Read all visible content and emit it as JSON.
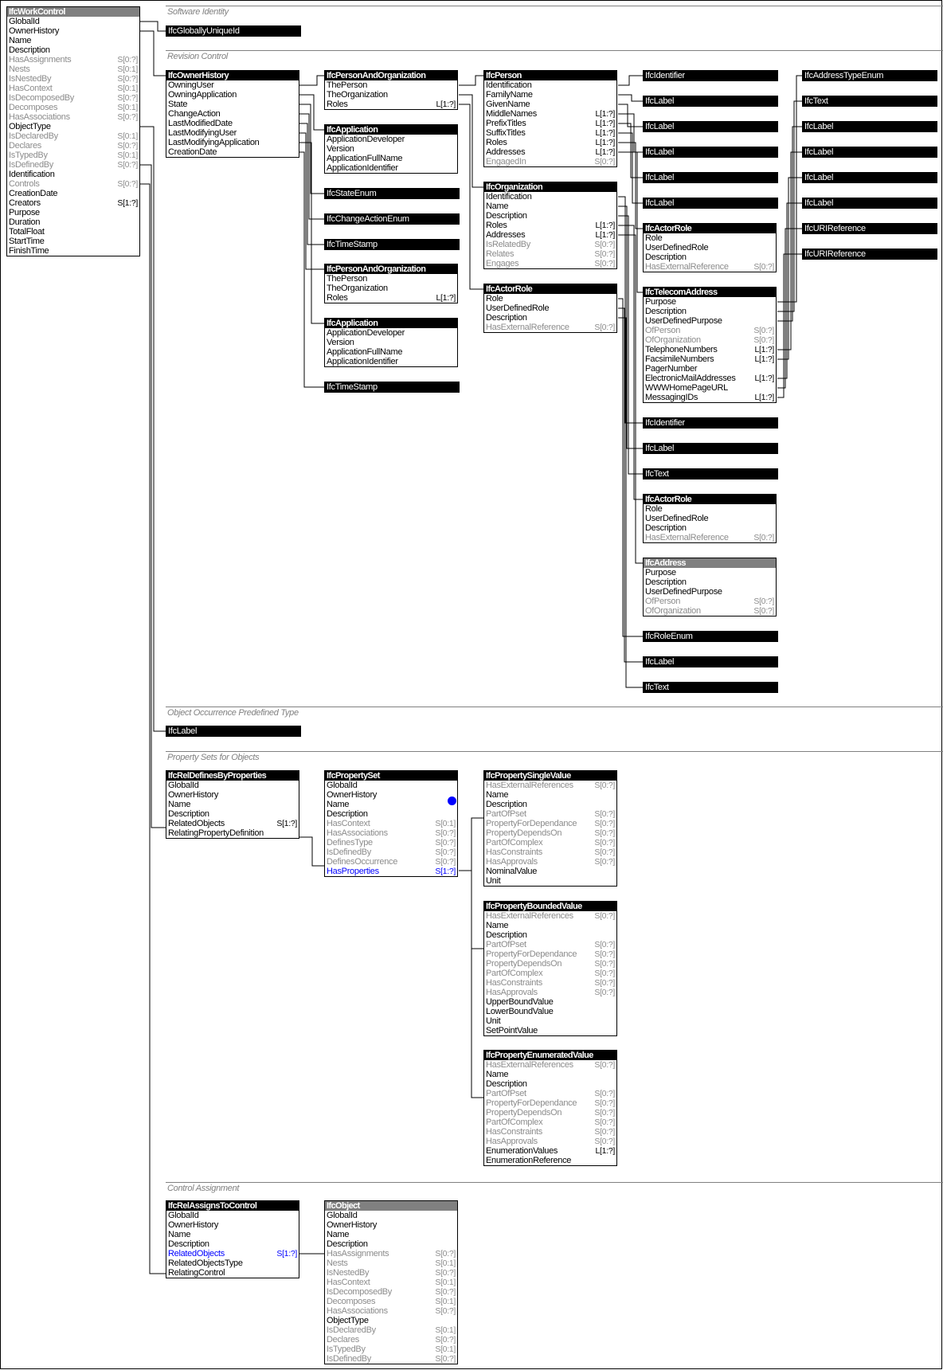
{
  "colors": {
    "header": "#000000",
    "abstract_header": "#808080",
    "inverse_attr": "#8c8c8c",
    "link_attr": "#0000ff",
    "section_title": "#808080",
    "selection_dot": "#0000ff"
  },
  "sections": [
    {
      "title": "Software Identity"
    },
    {
      "title": "Revision Control"
    },
    {
      "title": "Object Occurrence Predefined Type"
    },
    {
      "title": "Property Sets for Objects"
    },
    {
      "title": "Control Assignment"
    }
  ],
  "entities": {
    "work_control": {
      "name": "IfcWorkControl",
      "abstract": true,
      "attrs": [
        {
          "n": "GlobalId"
        },
        {
          "n": "OwnerHistory"
        },
        {
          "n": "Name"
        },
        {
          "n": "Description"
        },
        {
          "n": "HasAssignments",
          "c": "S[0:?]",
          "inv": true
        },
        {
          "n": "Nests",
          "c": "S[0:1]",
          "inv": true
        },
        {
          "n": "IsNestedBy",
          "c": "S[0:?]",
          "inv": true
        },
        {
          "n": "HasContext",
          "c": "S[0:1]",
          "inv": true
        },
        {
          "n": "IsDecomposedBy",
          "c": "S[0:?]",
          "inv": true
        },
        {
          "n": "Decomposes",
          "c": "S[0:1]",
          "inv": true
        },
        {
          "n": "HasAssociations",
          "c": "S[0:?]",
          "inv": true
        },
        {
          "n": "ObjectType"
        },
        {
          "n": "IsDeclaredBy",
          "c": "S[0:1]",
          "inv": true
        },
        {
          "n": "Declares",
          "c": "S[0:?]",
          "inv": true
        },
        {
          "n": "IsTypedBy",
          "c": "S[0:1]",
          "inv": true
        },
        {
          "n": "IsDefinedBy",
          "c": "S[0:?]",
          "inv": true
        },
        {
          "n": "Identification"
        },
        {
          "n": "Controls",
          "c": "S[0:?]",
          "inv": true
        },
        {
          "n": "CreationDate"
        },
        {
          "n": "Creators",
          "c": "S[1:?]"
        },
        {
          "n": "Purpose"
        },
        {
          "n": "Duration"
        },
        {
          "n": "TotalFloat"
        },
        {
          "n": "StartTime"
        },
        {
          "n": "FinishTime"
        }
      ]
    },
    "owner_history": {
      "name": "IfcOwnerHistory",
      "attrs": [
        {
          "n": "OwningUser"
        },
        {
          "n": "OwningApplication"
        },
        {
          "n": "State"
        },
        {
          "n": "ChangeAction"
        },
        {
          "n": "LastModifiedDate"
        },
        {
          "n": "LastModifyingUser"
        },
        {
          "n": "LastModifyingApplication"
        },
        {
          "n": "CreationDate"
        }
      ]
    },
    "person_and_org_1": {
      "name": "IfcPersonAndOrganization",
      "attrs": [
        {
          "n": "ThePerson"
        },
        {
          "n": "TheOrganization"
        },
        {
          "n": "Roles",
          "c": "L[1:?]"
        }
      ]
    },
    "application_1": {
      "name": "IfcApplication",
      "attrs": [
        {
          "n": "ApplicationDeveloper"
        },
        {
          "n": "Version"
        },
        {
          "n": "ApplicationFullName"
        },
        {
          "n": "ApplicationIdentifier"
        }
      ]
    },
    "person_and_org_2": {
      "name": "IfcPersonAndOrganization",
      "attrs": [
        {
          "n": "ThePerson"
        },
        {
          "n": "TheOrganization"
        },
        {
          "n": "Roles",
          "c": "L[1:?]"
        }
      ]
    },
    "application_2": {
      "name": "IfcApplication",
      "attrs": [
        {
          "n": "ApplicationDeveloper"
        },
        {
          "n": "Version"
        },
        {
          "n": "ApplicationFullName"
        },
        {
          "n": "ApplicationIdentifier"
        }
      ]
    },
    "person": {
      "name": "IfcPerson",
      "attrs": [
        {
          "n": "Identification"
        },
        {
          "n": "FamilyName"
        },
        {
          "n": "GivenName"
        },
        {
          "n": "MiddleNames",
          "c": "L[1:?]"
        },
        {
          "n": "PrefixTitles",
          "c": "L[1:?]"
        },
        {
          "n": "SuffixTitles",
          "c": "L[1:?]"
        },
        {
          "n": "Roles",
          "c": "L[1:?]"
        },
        {
          "n": "Addresses",
          "c": "L[1:?]"
        },
        {
          "n": "EngagedIn",
          "c": "S[0:?]",
          "inv": true
        }
      ]
    },
    "organization": {
      "name": "IfcOrganization",
      "attrs": [
        {
          "n": "Identification"
        },
        {
          "n": "Name"
        },
        {
          "n": "Description"
        },
        {
          "n": "Roles",
          "c": "L[1:?]"
        },
        {
          "n": "Addresses",
          "c": "L[1:?]"
        },
        {
          "n": "IsRelatedBy",
          "c": "S[0:?]",
          "inv": true
        },
        {
          "n": "Relates",
          "c": "S[0:?]",
          "inv": true
        },
        {
          "n": "Engages",
          "c": "S[0:?]",
          "inv": true
        }
      ]
    },
    "actor_role_1": {
      "name": "IfcActorRole",
      "attrs": [
        {
          "n": "Role"
        },
        {
          "n": "UserDefinedRole"
        },
        {
          "n": "Description"
        },
        {
          "n": "HasExternalReference",
          "c": "S[0:?]",
          "inv": true
        }
      ]
    },
    "actor_role_2": {
      "name": "IfcActorRole",
      "attrs": [
        {
          "n": "Role"
        },
        {
          "n": "UserDefinedRole"
        },
        {
          "n": "Description"
        },
        {
          "n": "HasExternalReference",
          "c": "S[0:?]",
          "inv": true
        }
      ]
    },
    "actor_role_3": {
      "name": "IfcActorRole",
      "attrs": [
        {
          "n": "Role"
        },
        {
          "n": "UserDefinedRole"
        },
        {
          "n": "Description"
        },
        {
          "n": "HasExternalReference",
          "c": "S[0:?]",
          "inv": true
        }
      ]
    },
    "telecom_address": {
      "name": "IfcTelecomAddress",
      "attrs": [
        {
          "n": "Purpose"
        },
        {
          "n": "Description"
        },
        {
          "n": "UserDefinedPurpose"
        },
        {
          "n": "OfPerson",
          "c": "S[0:?]",
          "inv": true
        },
        {
          "n": "OfOrganization",
          "c": "S[0:?]",
          "inv": true
        },
        {
          "n": "TelephoneNumbers",
          "c": "L[1:?]"
        },
        {
          "n": "FacsimileNumbers",
          "c": "L[1:?]"
        },
        {
          "n": "PagerNumber"
        },
        {
          "n": "ElectronicMailAddresses",
          "c": "L[1:?]"
        },
        {
          "n": "WWWHomePageURL"
        },
        {
          "n": "MessagingIDs",
          "c": "L[1:?]"
        }
      ]
    },
    "address": {
      "name": "IfcAddress",
      "abstract": true,
      "attrs": [
        {
          "n": "Purpose"
        },
        {
          "n": "Description"
        },
        {
          "n": "UserDefinedPurpose"
        },
        {
          "n": "OfPerson",
          "c": "S[0:?]",
          "inv": true
        },
        {
          "n": "OfOrganization",
          "c": "S[0:?]",
          "inv": true
        }
      ]
    },
    "rel_defines_by_properties": {
      "name": "IfcRelDefinesByProperties",
      "attrs": [
        {
          "n": "GlobalId"
        },
        {
          "n": "OwnerHistory"
        },
        {
          "n": "Name"
        },
        {
          "n": "Description"
        },
        {
          "n": "RelatedObjects",
          "c": "S[1:?]"
        },
        {
          "n": "RelatingPropertyDefinition"
        }
      ]
    },
    "property_set": {
      "name": "IfcPropertySet",
      "attrs": [
        {
          "n": "GlobalId"
        },
        {
          "n": "OwnerHistory"
        },
        {
          "n": "Name"
        },
        {
          "n": "Description"
        },
        {
          "n": "HasContext",
          "c": "S[0:1]",
          "inv": true
        },
        {
          "n": "HasAssociations",
          "c": "S[0:?]",
          "inv": true
        },
        {
          "n": "DefinesType",
          "c": "S[0:?]",
          "inv": true
        },
        {
          "n": "IsDefinedBy",
          "c": "S[0:?]",
          "inv": true
        },
        {
          "n": "DefinesOccurrence",
          "c": "S[0:?]",
          "inv": true
        },
        {
          "n": "HasProperties",
          "c": "S[1:?]",
          "link": true
        }
      ]
    },
    "property_single_value": {
      "name": "IfcPropertySingleValue",
      "attrs": [
        {
          "n": "HasExternalReferences",
          "c": "S[0:?]",
          "inv": true
        },
        {
          "n": "Name"
        },
        {
          "n": "Description"
        },
        {
          "n": "PartOfPset",
          "c": "S[0:?]",
          "inv": true
        },
        {
          "n": "PropertyForDependance",
          "c": "S[0:?]",
          "inv": true
        },
        {
          "n": "PropertyDependsOn",
          "c": "S[0:?]",
          "inv": true
        },
        {
          "n": "PartOfComplex",
          "c": "S[0:?]",
          "inv": true
        },
        {
          "n": "HasConstraints",
          "c": "S[0:?]",
          "inv": true
        },
        {
          "n": "HasApprovals",
          "c": "S[0:?]",
          "inv": true
        },
        {
          "n": "NominalValue"
        },
        {
          "n": "Unit"
        }
      ]
    },
    "property_bounded_value": {
      "name": "IfcPropertyBoundedValue",
      "attrs": [
        {
          "n": "HasExternalReferences",
          "c": "S[0:?]",
          "inv": true
        },
        {
          "n": "Name"
        },
        {
          "n": "Description"
        },
        {
          "n": "PartOfPset",
          "c": "S[0:?]",
          "inv": true
        },
        {
          "n": "PropertyForDependance",
          "c": "S[0:?]",
          "inv": true
        },
        {
          "n": "PropertyDependsOn",
          "c": "S[0:?]",
          "inv": true
        },
        {
          "n": "PartOfComplex",
          "c": "S[0:?]",
          "inv": true
        },
        {
          "n": "HasConstraints",
          "c": "S[0:?]",
          "inv": true
        },
        {
          "n": "HasApprovals",
          "c": "S[0:?]",
          "inv": true
        },
        {
          "n": "UpperBoundValue"
        },
        {
          "n": "LowerBoundValue"
        },
        {
          "n": "Unit"
        },
        {
          "n": "SetPointValue"
        }
      ]
    },
    "property_enumerated_value": {
      "name": "IfcPropertyEnumeratedValue",
      "attrs": [
        {
          "n": "HasExternalReferences",
          "c": "S[0:?]",
          "inv": true
        },
        {
          "n": "Name"
        },
        {
          "n": "Description"
        },
        {
          "n": "PartOfPset",
          "c": "S[0:?]",
          "inv": true
        },
        {
          "n": "PropertyForDependance",
          "c": "S[0:?]",
          "inv": true
        },
        {
          "n": "PropertyDependsOn",
          "c": "S[0:?]",
          "inv": true
        },
        {
          "n": "PartOfComplex",
          "c": "S[0:?]",
          "inv": true
        },
        {
          "n": "HasConstraints",
          "c": "S[0:?]",
          "inv": true
        },
        {
          "n": "HasApprovals",
          "c": "S[0:?]",
          "inv": true
        },
        {
          "n": "EnumerationValues",
          "c": "L[1:?]"
        },
        {
          "n": "EnumerationReference"
        }
      ]
    },
    "rel_assigns_to_control": {
      "name": "IfcRelAssignsToControl",
      "attrs": [
        {
          "n": "GlobalId"
        },
        {
          "n": "OwnerHistory"
        },
        {
          "n": "Name"
        },
        {
          "n": "Description"
        },
        {
          "n": "RelatedObjects",
          "c": "S[1:?]",
          "link": true
        },
        {
          "n": "RelatedObjectsType"
        },
        {
          "n": "RelatingControl"
        }
      ]
    },
    "object": {
      "name": "IfcObject",
      "abstract": true,
      "attrs": [
        {
          "n": "GlobalId"
        },
        {
          "n": "OwnerHistory"
        },
        {
          "n": "Name"
        },
        {
          "n": "Description"
        },
        {
          "n": "HasAssignments",
          "c": "S[0:?]",
          "inv": true
        },
        {
          "n": "Nests",
          "c": "S[0:1]",
          "inv": true
        },
        {
          "n": "IsNestedBy",
          "c": "S[0:?]",
          "inv": true
        },
        {
          "n": "HasContext",
          "c": "S[0:1]",
          "inv": true
        },
        {
          "n": "IsDecomposedBy",
          "c": "S[0:?]",
          "inv": true
        },
        {
          "n": "Decomposes",
          "c": "S[0:1]",
          "inv": true
        },
        {
          "n": "HasAssociations",
          "c": "S[0:?]",
          "inv": true
        },
        {
          "n": "ObjectType"
        },
        {
          "n": "IsDeclaredBy",
          "c": "S[0:1]",
          "inv": true
        },
        {
          "n": "Declares",
          "c": "S[0:?]",
          "inv": true
        },
        {
          "n": "IsTypedBy",
          "c": "S[0:1]",
          "inv": true
        },
        {
          "n": "IsDefinedBy",
          "c": "S[0:?]",
          "inv": true
        }
      ]
    }
  },
  "types": {
    "globally_unique_id": "IfcGloballyUniqueId",
    "state_enum": "IfcStateEnum",
    "change_action_enum": "IfcChangeActionEnum",
    "timestamp_1": "IfcTimeStamp",
    "timestamp_2": "IfcTimeStamp",
    "person_identifier": "IfcIdentifier",
    "person_label_1": "IfcLabel",
    "person_label_2": "IfcLabel",
    "person_label_3": "IfcLabel",
    "person_label_4": "IfcLabel",
    "person_label_5": "IfcLabel",
    "org_identifier": "IfcIdentifier",
    "org_label": "IfcLabel",
    "org_text": "IfcText",
    "role_enum": "IfcRoleEnum",
    "role_label": "IfcLabel",
    "role_text": "IfcText",
    "addr_type_enum": "IfcAddressTypeEnum",
    "addr_text": "IfcText",
    "addr_label_1": "IfcLabel",
    "addr_label_2": "IfcLabel",
    "addr_label_3": "IfcLabel",
    "addr_label_4": "IfcLabel",
    "addr_uri_1": "IfcURIReference",
    "addr_uri_2": "IfcURIReference",
    "object_type_label": "IfcLabel"
  }
}
